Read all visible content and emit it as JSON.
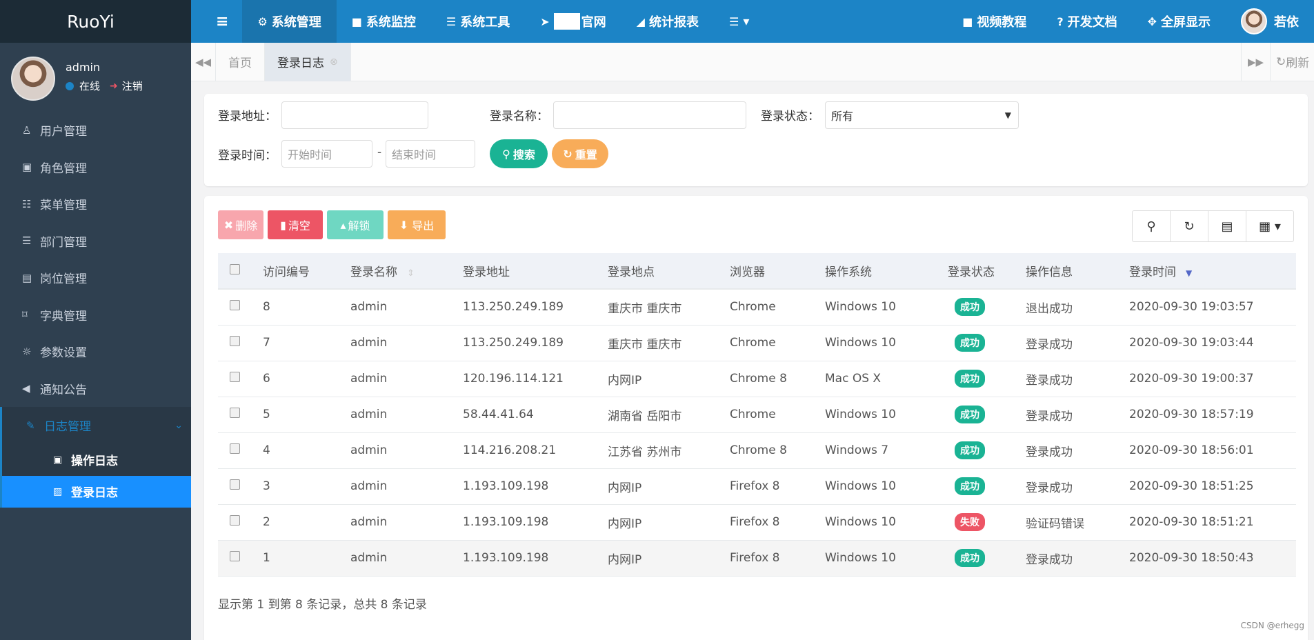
{
  "app": {
    "brand": "RuoYi"
  },
  "user": {
    "name": "admin",
    "status": "在线",
    "logout": "注销",
    "nav_name": "若依"
  },
  "sidebar": {
    "items": [
      {
        "label": "用户管理",
        "icon": "user-icon"
      },
      {
        "label": "角色管理",
        "icon": "lock-icon"
      },
      {
        "label": "菜单管理",
        "icon": "list-icon"
      },
      {
        "label": "部门管理",
        "icon": "outdent-icon"
      },
      {
        "label": "岗位管理",
        "icon": "id-card-icon"
      },
      {
        "label": "字典管理",
        "icon": "bookmark-icon"
      },
      {
        "label": "参数设置",
        "icon": "sun-icon"
      },
      {
        "label": "通知公告",
        "icon": "bullhorn-icon"
      },
      {
        "label": "日志管理",
        "icon": "edit-icon"
      }
    ],
    "sub_items": [
      {
        "label": "操作日志",
        "icon": "address-book-icon"
      },
      {
        "label": "登录日志",
        "icon": "image-icon"
      }
    ]
  },
  "topnav": {
    "items": [
      {
        "label": "系统管理",
        "icon": "gear-icon"
      },
      {
        "label": "系统监控",
        "icon": "video-icon"
      },
      {
        "label": "系统工具",
        "icon": "bars-icon"
      },
      {
        "label": "官网",
        "icon": "location-arrow-icon"
      },
      {
        "label": "统计报表",
        "icon": "area-chart-icon"
      }
    ],
    "right": [
      {
        "label": "视频教程",
        "icon": "video-icon"
      },
      {
        "label": "开发文档",
        "icon": "question-icon"
      },
      {
        "label": "全屏显示",
        "icon": "expand-icon"
      }
    ]
  },
  "tabs": {
    "home": "首页",
    "current": "登录日志",
    "refresh": "刷新"
  },
  "search": {
    "ipaddr_label": "登录地址：",
    "name_label": "登录名称：",
    "status_label": "登录状态：",
    "status_value": "所有",
    "time_label": "登录时间：",
    "start_placeholder": "开始时间",
    "dash": "-",
    "end_placeholder": "结束时间",
    "search_btn": "搜索",
    "reset_btn": "重置"
  },
  "toolbar": {
    "delete": "删除",
    "clean": "清空",
    "unlock": "解锁",
    "export": "导出"
  },
  "colors": {
    "delete": "#f8a6ad",
    "clean": "#ed5565",
    "unlock": "#6fd7c2",
    "export": "#f8ac59",
    "search": "#1ab394",
    "reset": "#f8ac59"
  },
  "table": {
    "headers": [
      "访问编号",
      "登录名称",
      "登录地址",
      "登录地点",
      "浏览器",
      "操作系统",
      "登录状态",
      "操作信息",
      "登录时间"
    ],
    "rows": [
      {
        "id": "8",
        "name": "admin",
        "ip": "113.250.249.189",
        "location": "重庆市 重庆市",
        "browser": "Chrome",
        "os": "Windows 10",
        "status": "成功",
        "msg": "退出成功",
        "time": "2020-09-30 19:03:57"
      },
      {
        "id": "7",
        "name": "admin",
        "ip": "113.250.249.189",
        "location": "重庆市 重庆市",
        "browser": "Chrome",
        "os": "Windows 10",
        "status": "成功",
        "msg": "登录成功",
        "time": "2020-09-30 19:03:44"
      },
      {
        "id": "6",
        "name": "admin",
        "ip": "120.196.114.121",
        "location": "内网IP",
        "browser": "Chrome 8",
        "os": "Mac OS X",
        "status": "成功",
        "msg": "登录成功",
        "time": "2020-09-30 19:00:37"
      },
      {
        "id": "5",
        "name": "admin",
        "ip": "58.44.41.64",
        "location": "湖南省 岳阳市",
        "browser": "Chrome",
        "os": "Windows 10",
        "status": "成功",
        "msg": "登录成功",
        "time": "2020-09-30 18:57:19"
      },
      {
        "id": "4",
        "name": "admin",
        "ip": "114.216.208.21",
        "location": "江苏省 苏州市",
        "browser": "Chrome 8",
        "os": "Windows 7",
        "status": "成功",
        "msg": "登录成功",
        "time": "2020-09-30 18:56:01"
      },
      {
        "id": "3",
        "name": "admin",
        "ip": "1.193.109.198",
        "location": "内网IP",
        "browser": "Firefox 8",
        "os": "Windows 10",
        "status": "成功",
        "msg": "登录成功",
        "time": "2020-09-30 18:51:25"
      },
      {
        "id": "2",
        "name": "admin",
        "ip": "1.193.109.198",
        "location": "内网IP",
        "browser": "Firefox 8",
        "os": "Windows 10",
        "status": "失败",
        "msg": "验证码错误",
        "time": "2020-09-30 18:51:21"
      },
      {
        "id": "1",
        "name": "admin",
        "ip": "1.193.109.198",
        "location": "内网IP",
        "browser": "Firefox 8",
        "os": "Windows 10",
        "status": "成功",
        "msg": "登录成功",
        "time": "2020-09-30 18:50:43"
      }
    ]
  },
  "pager": {
    "info": "显示第 1 到第 8 条记录，总共 8 条记录"
  },
  "watermark": "CSDN @erhegg"
}
